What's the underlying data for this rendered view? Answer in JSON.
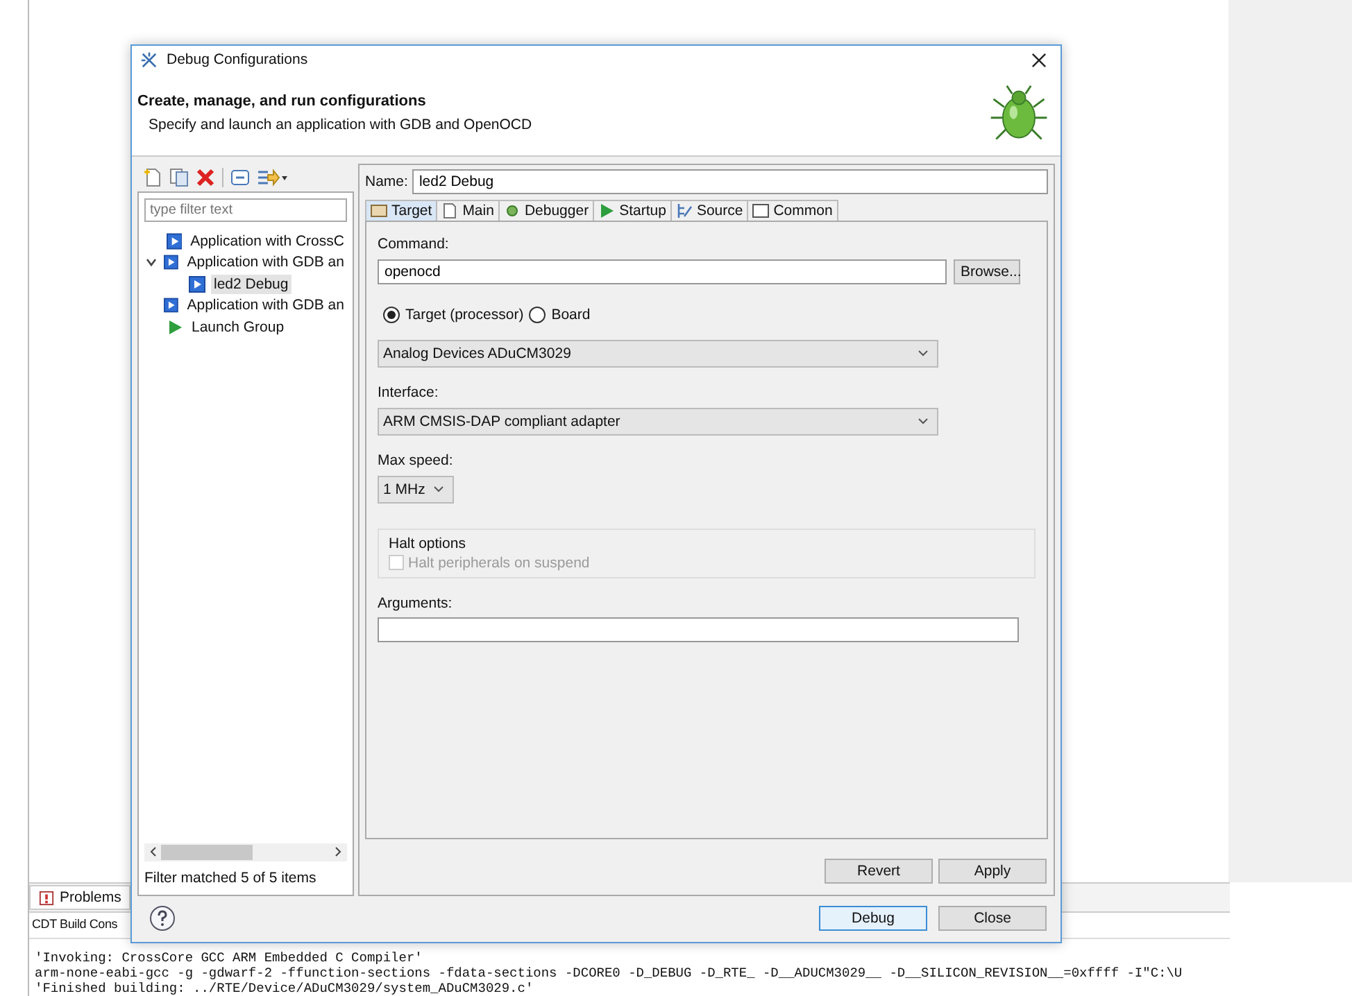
{
  "background": {
    "problems_tab": "Problems",
    "console_tab": "CDT Build Cons",
    "console_lines": [
      "'Invoking: CrossCore GCC ARM Embedded C Compiler'",
      "arm-none-eabi-gcc -g -gdwarf-2 -ffunction-sections -fdata-sections -DCORE0 -D_DEBUG -D_RTE_ -D__ADUCM3029__ -D__SILICON_REVISION__=0xffff -I\"C:\\U",
      "'Finished building: ../RTE/Device/ADuCM3029/system_ADuCM3029.c'"
    ]
  },
  "dialog": {
    "title": "Debug Configurations",
    "heading": "Create, manage, and run configurations",
    "description": "Specify and launch an application with GDB and OpenOCD",
    "filter": {
      "placeholder": "type filter text"
    },
    "tree": [
      {
        "label": "Application with CrossC",
        "kind": "launch",
        "selected": false
      },
      {
        "label": "Application with GDB an",
        "kind": "launch",
        "selected": false,
        "expanded": true,
        "children": [
          {
            "label": "led2 Debug",
            "kind": "launch",
            "selected": true
          }
        ]
      },
      {
        "label": "Application with GDB an",
        "kind": "launch",
        "selected": false
      },
      {
        "label": "Launch Group",
        "kind": "group",
        "selected": false
      }
    ],
    "filter_status": "Filter matched 5 of 5 items",
    "name": {
      "label": "Name:",
      "value": "led2 Debug"
    },
    "tabs": [
      {
        "label": "Target",
        "selected": true
      },
      {
        "label": "Main",
        "selected": false
      },
      {
        "label": "Debugger",
        "selected": false
      },
      {
        "label": "Startup",
        "selected": false
      },
      {
        "label": "Source",
        "selected": false
      },
      {
        "label": "Common",
        "selected": false
      }
    ],
    "command": {
      "label": "Command:",
      "value": "openocd",
      "button": "Browse..."
    },
    "radios": [
      {
        "label": "Target (processor)",
        "selected": true
      },
      {
        "label": "Board",
        "selected": false
      }
    ],
    "device": {
      "value": "Analog Devices ADuCM3029"
    },
    "interface": {
      "label": "Interface:",
      "value": "ARM CMSIS-DAP compliant adapter"
    },
    "max_speed": {
      "label": "Max speed:",
      "value": "1 MHz"
    },
    "halt": {
      "title": "Halt options",
      "checkbox": {
        "label": "Halt peripherals on suspend",
        "checked": false,
        "disabled": true
      }
    },
    "arguments": {
      "label": "Arguments:"
    },
    "buttons": {
      "revert": "Revert",
      "apply": "Apply",
      "debug": "Debug",
      "close": "Close"
    }
  }
}
